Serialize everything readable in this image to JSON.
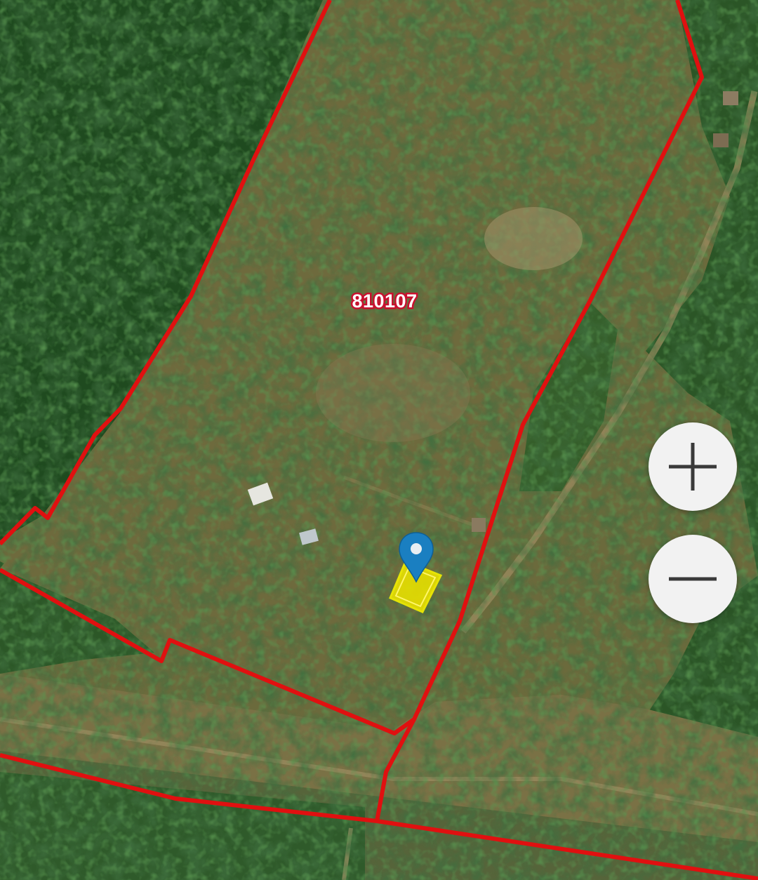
{
  "map": {
    "type": "satellite cadastral map",
    "boundary_color": "#e01010",
    "selected_parcel_color": "#f0e000",
    "marker_color": "#1a7fc1",
    "parcel_label": "810107"
  },
  "controls": {
    "zoom_in_icon": "plus-icon",
    "zoom_out_icon": "minus-icon"
  }
}
